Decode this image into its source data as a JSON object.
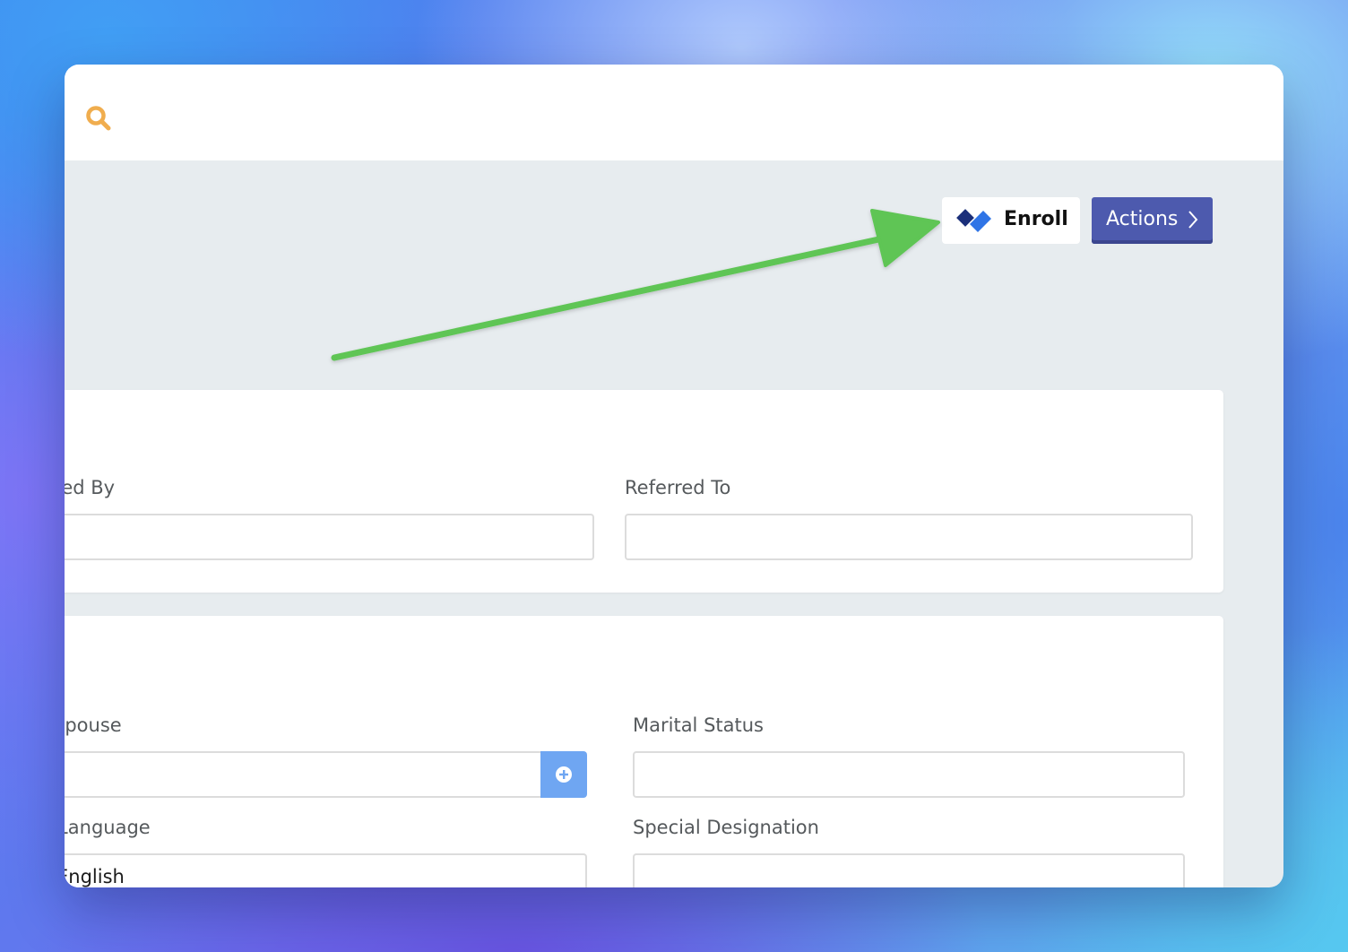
{
  "toolbar": {
    "enroll_label": "Enroll",
    "actions_label": "Actions",
    "search_icon": "search-icon",
    "accent_color": "#f0ad4e"
  },
  "referral_section": {
    "referred_by": {
      "label": "Referred By",
      "value": ""
    },
    "referred_to": {
      "label": "Referred To",
      "value": ""
    }
  },
  "personal_section": {
    "spouse": {
      "label": "Spouse",
      "value": "",
      "add_icon": "plus-circle-icon"
    },
    "marital_status": {
      "label": "Marital Status",
      "value": ""
    },
    "preferred_language": {
      "label": "Preferred Language",
      "value": "English"
    },
    "special_designation": {
      "label": "Special Designation",
      "value": ""
    }
  },
  "annotation": {
    "arrow_color": "#5ec554"
  }
}
